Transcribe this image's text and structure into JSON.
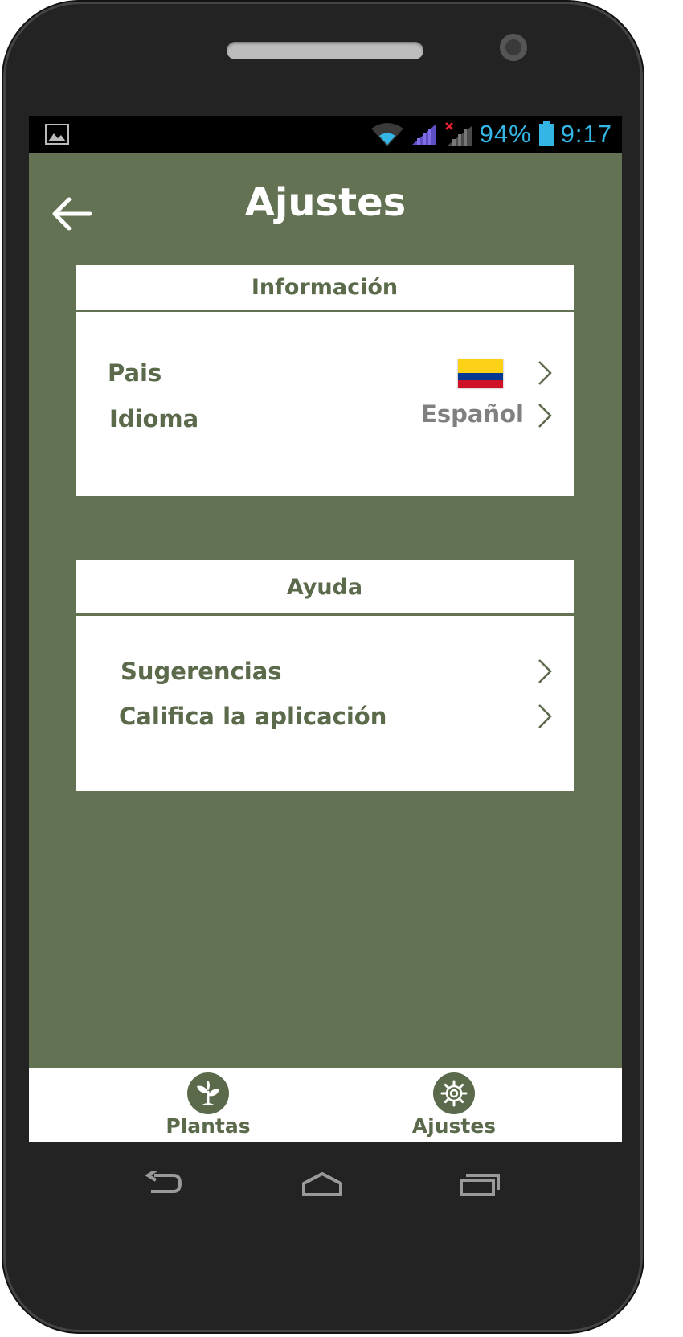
{
  "status_bar": {
    "battery_percent": "94%",
    "time": "9:17",
    "icons": [
      "image-icon",
      "wifi-icon",
      "signal-icon",
      "no-signal-icon",
      "battery-icon"
    ],
    "accent_color": "#33b5e5"
  },
  "header": {
    "title": "Ajustes",
    "back_icon": "arrow-left-icon"
  },
  "info_section": {
    "title": "Información",
    "rows": [
      {
        "label": "Pais",
        "value_flag": "colombia-flag-icon"
      },
      {
        "label": "Idioma",
        "value": "Español"
      }
    ]
  },
  "help_section": {
    "title": "Ayuda",
    "rows": [
      {
        "label": "Sugerencias"
      },
      {
        "label": "Califica la aplicación"
      }
    ]
  },
  "bottom_nav": {
    "items": [
      {
        "label": "Plantas",
        "icon": "plant-icon"
      },
      {
        "label": "Ajustes",
        "icon": "gear-icon"
      }
    ]
  },
  "hardware_buttons": [
    "back-icon",
    "home-icon",
    "recent-apps-icon"
  ],
  "colors": {
    "app_background": "#647254",
    "accent_text": "#5b6a4b",
    "secondary_text": "#808080",
    "card": "#ffffff"
  }
}
